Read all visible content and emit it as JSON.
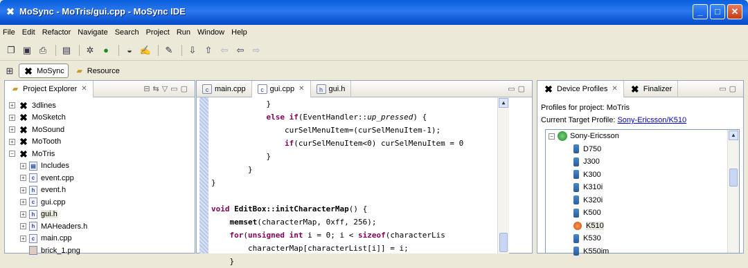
{
  "window": {
    "title": "MoSync - MoTris/gui.cpp - MoSync IDE"
  },
  "menu": [
    "File",
    "Edit",
    "Refactor",
    "Navigate",
    "Search",
    "Project",
    "Run",
    "Window",
    "Help"
  ],
  "perspectives": [
    {
      "label": "MoSync",
      "active": true
    },
    {
      "label": "Resource",
      "active": false
    }
  ],
  "explorer": {
    "tab": "Project Explorer",
    "tree": [
      {
        "label": "3dlines",
        "type": "project",
        "expand": "+",
        "level": 0
      },
      {
        "label": "MoSketch",
        "type": "project",
        "expand": "+",
        "level": 0
      },
      {
        "label": "MoSound",
        "type": "project",
        "expand": "+",
        "level": 0
      },
      {
        "label": "MoTooth",
        "type": "project",
        "expand": "+",
        "level": 0
      },
      {
        "label": "MoTris",
        "type": "project",
        "expand": "-",
        "level": 0
      },
      {
        "label": "Includes",
        "type": "includes",
        "expand": "+",
        "level": 1
      },
      {
        "label": "event.cpp",
        "type": "c",
        "expand": "+",
        "level": 1
      },
      {
        "label": "event.h",
        "type": "h",
        "expand": "+",
        "level": 1
      },
      {
        "label": "gui.cpp",
        "type": "c",
        "expand": "+",
        "level": 1
      },
      {
        "label": "gui.h",
        "type": "h",
        "expand": "+",
        "level": 1,
        "selected": true
      },
      {
        "label": "MAHeaders.h",
        "type": "h",
        "expand": "+",
        "level": 1
      },
      {
        "label": "main.cpp",
        "type": "c",
        "expand": "+",
        "level": 1
      },
      {
        "label": "brick_1.png",
        "type": "png",
        "expand": "",
        "level": 1
      }
    ]
  },
  "editor": {
    "tabs": [
      {
        "label": "main.cpp",
        "icon": "c"
      },
      {
        "label": "gui.cpp",
        "icon": "c",
        "active": true
      },
      {
        "label": "gui.h",
        "icon": "h"
      }
    ],
    "lines": [
      [
        {
          "t": "            }"
        }
      ],
      [
        {
          "t": "            "
        },
        {
          "t": "else if",
          "c": "kw"
        },
        {
          "t": "(EventHandler::"
        },
        {
          "t": "up_pressed",
          "c": "it"
        },
        {
          "t": ") {"
        }
      ],
      [
        {
          "t": "                curSelMenuItem=(curSelMenuItem-1);"
        }
      ],
      [
        {
          "t": "                "
        },
        {
          "t": "if",
          "c": "kw"
        },
        {
          "t": "(curSelMenuItem<0) curSelMenuItem = 0"
        }
      ],
      [
        {
          "t": "            }"
        }
      ],
      [
        {
          "t": "        }"
        }
      ],
      [
        {
          "t": "}"
        }
      ],
      [
        {
          "t": ""
        }
      ],
      [
        {
          "t": "void",
          "c": "kw"
        },
        {
          "t": " "
        },
        {
          "t": "EditBox::initCharacterMap",
          "c": "b"
        },
        {
          "t": "() {"
        }
      ],
      [
        {
          "t": "    "
        },
        {
          "t": "memset",
          "c": "b"
        },
        {
          "t": "(characterMap, 0xff, 256);"
        }
      ],
      [
        {
          "t": "    "
        },
        {
          "t": "for",
          "c": "kw"
        },
        {
          "t": "("
        },
        {
          "t": "unsigned int",
          "c": "kw"
        },
        {
          "t": " i = 0; i < "
        },
        {
          "t": "sizeof",
          "c": "kw"
        },
        {
          "t": "(characterLis"
        }
      ],
      [
        {
          "t": "        characterMap[characterList[i]] = i;"
        }
      ],
      [
        {
          "t": "    }"
        }
      ]
    ]
  },
  "devices": {
    "tabs": [
      "Device Profiles",
      "Finalizer"
    ],
    "profiles_for": "Profiles for project: MoTris",
    "current_label": "Current Target Profile: ",
    "current_value": "Sony-Ericsson/K510",
    "vendor": "Sony-Ericsson",
    "list": [
      "D750",
      "J300",
      "K300",
      "K310i",
      "K320i",
      "K500",
      "K510",
      "K530",
      "K550im"
    ],
    "selected": "K510"
  }
}
